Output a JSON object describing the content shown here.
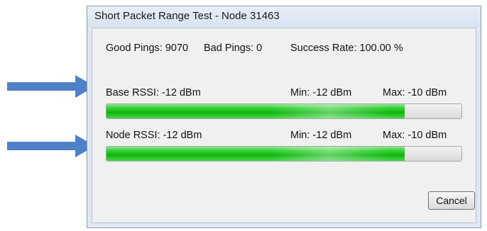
{
  "window": {
    "title": "Short Packet Range Test - Node 31463"
  },
  "stats": {
    "good_pings": "Good Pings: 9070",
    "bad_pings": "Bad Pings: 0",
    "success_rate": "Success Rate: 100.00 %"
  },
  "base": {
    "rssi": "Base  RSSI: -12 dBm",
    "min": "Min: -12 dBm",
    "max": "Max: -10 dBm",
    "level_fraction": 0.84
  },
  "node": {
    "rssi": "Node RSSI: -12 dBm",
    "min": "Min: -12 dBm",
    "max": "Max: -10 dBm",
    "level_fraction": 0.84
  },
  "buttons": {
    "cancel": "Cancel"
  },
  "colors": {
    "arrow": "#4f81c9",
    "progress_fill": "#22c322"
  },
  "icons": {
    "arrow": "arrow-right-icon"
  }
}
